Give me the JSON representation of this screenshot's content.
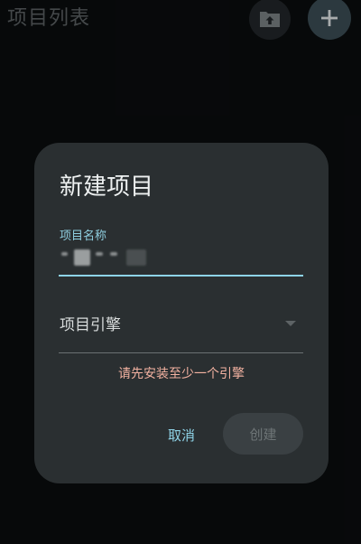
{
  "app_bar": {
    "title": "项目列表",
    "import_icon": "folder-upload-icon",
    "add_icon": "plus-icon",
    "add_symbol": "+"
  },
  "dialog": {
    "title": "新建项目",
    "name_label": "项目名称",
    "engine_label": "项目引擎",
    "engine_dropdown_icon": "dropdown-arrow-icon",
    "error": "请先安装至少一个引擎",
    "cancel_label": "取消",
    "create_label": "创建"
  },
  "colors": {
    "background": "#0b0d0f",
    "dialog": "#2a2f31",
    "accent": "#8ed4e8",
    "error": "#f3b2a1",
    "fab_add": "#3d5058",
    "fab_import": "#23282b",
    "disabled_button": "#3a4043"
  }
}
